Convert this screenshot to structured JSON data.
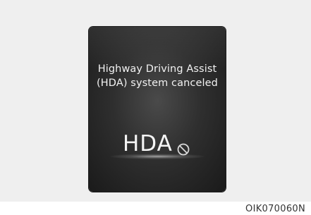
{
  "display": {
    "message_line1": "Highway Driving Assist",
    "message_line2": "(HDA) system canceled",
    "indicator_text": "HDA",
    "indicator_icon": "cancel-circle-slash-icon"
  },
  "figure_code": "OIK070060N",
  "colors": {
    "background": "#efefef",
    "screen": "#2f2f2f",
    "text": "#f2f2f2"
  }
}
